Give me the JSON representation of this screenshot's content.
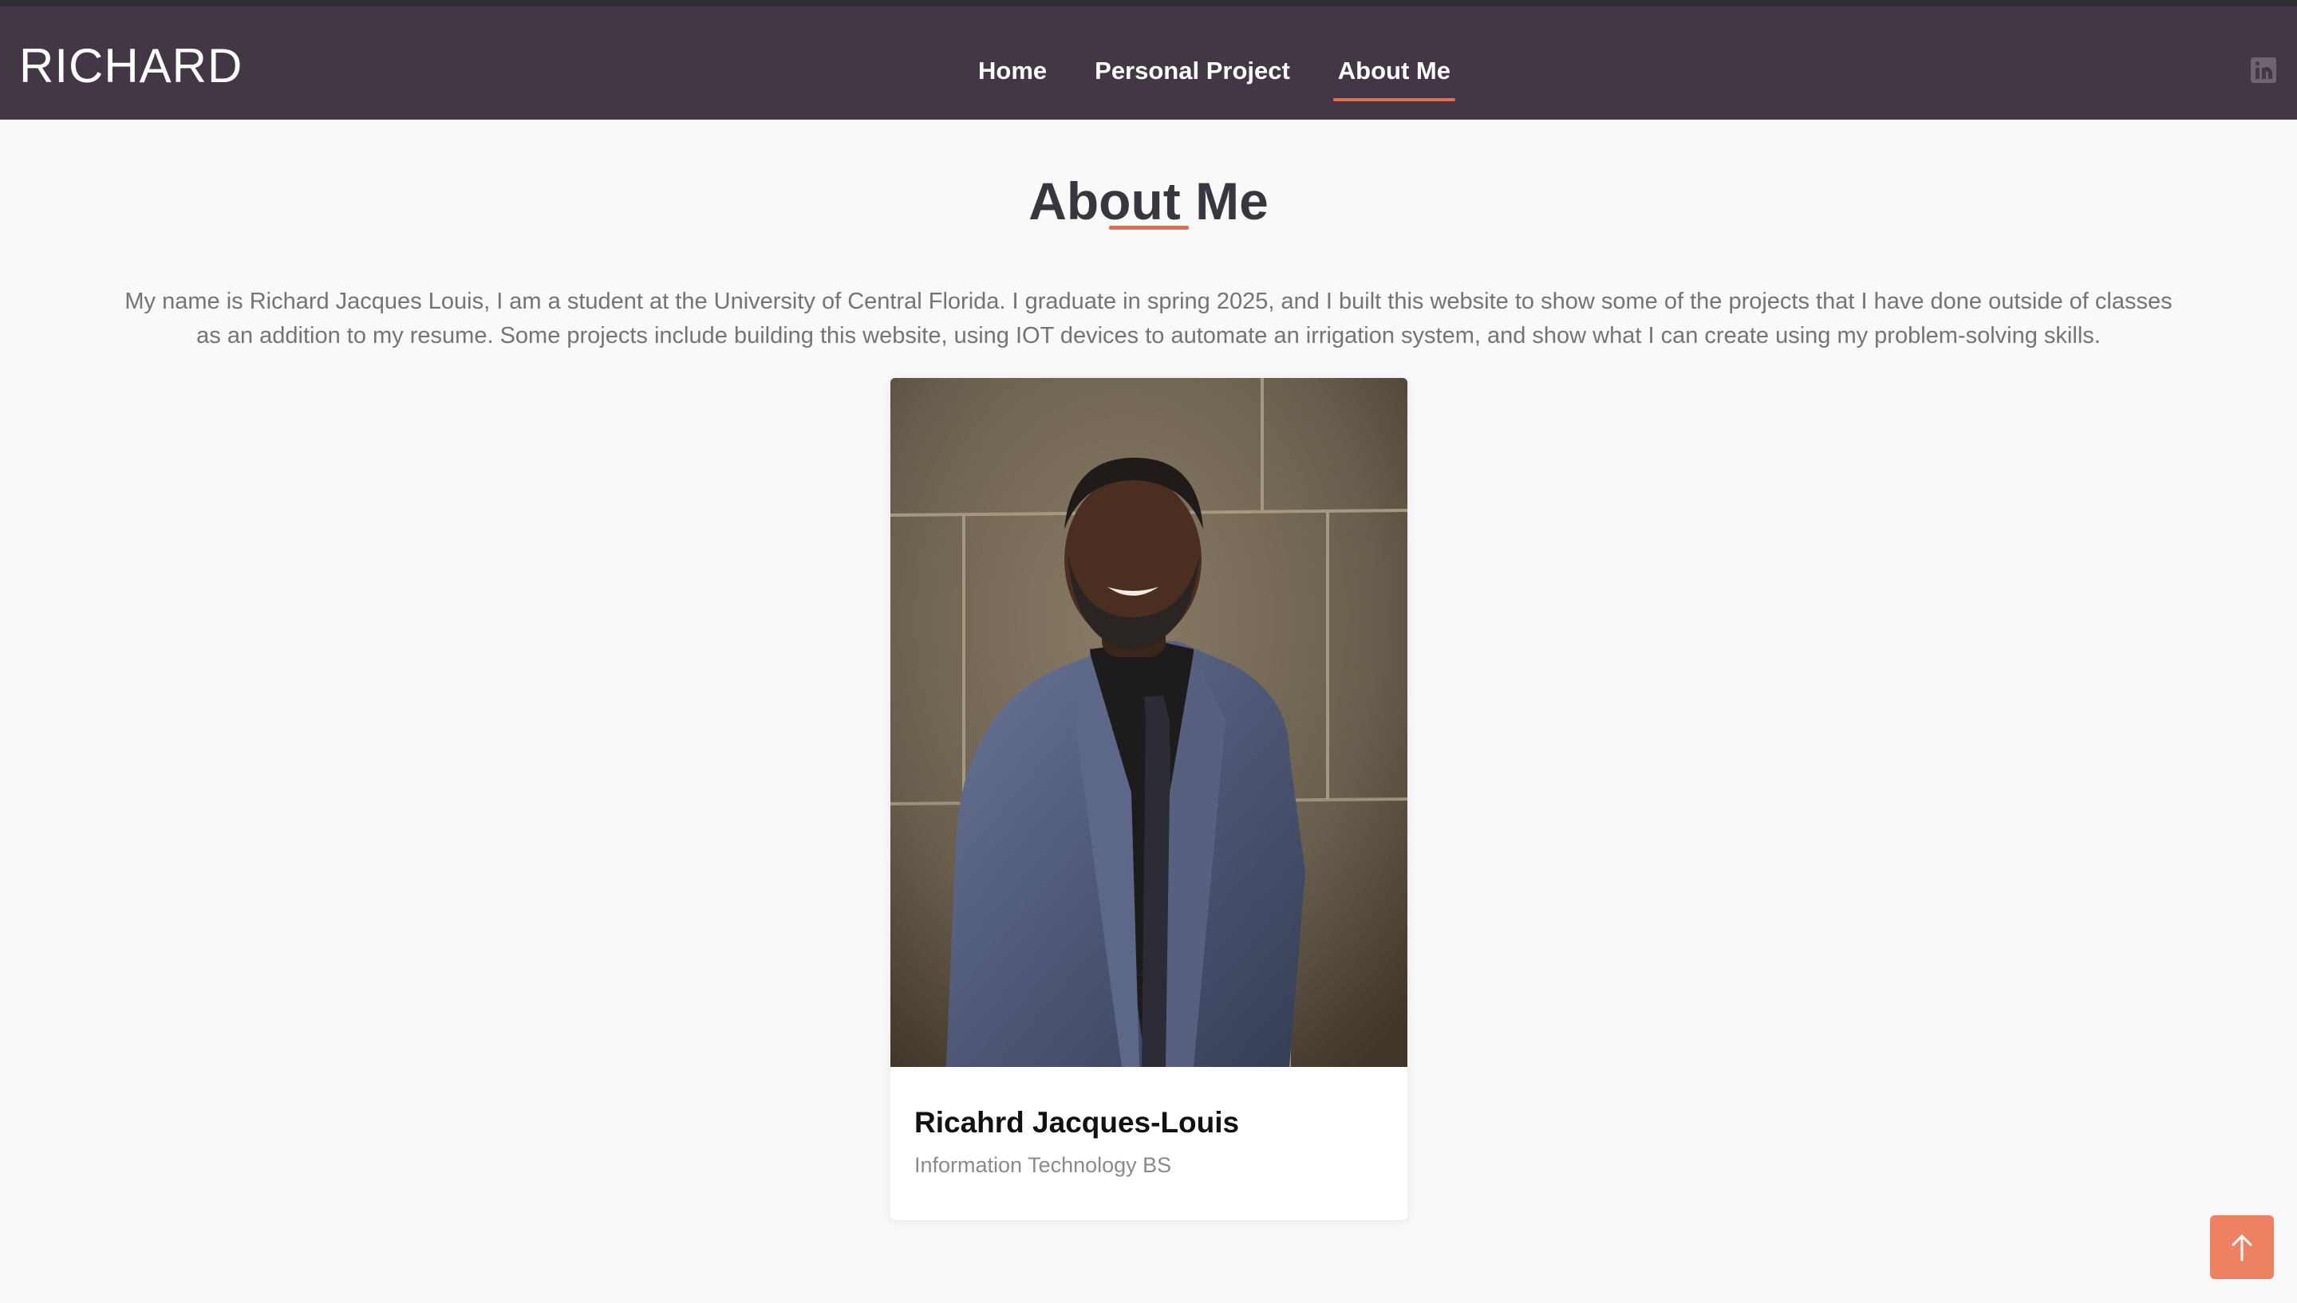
{
  "header": {
    "logo": "RICHARD",
    "nav": [
      {
        "label": "Home",
        "active": false
      },
      {
        "label": "Personal Project",
        "active": false
      },
      {
        "label": "About Me",
        "active": true
      }
    ],
    "social_icon": "linkedin-icon",
    "colors": {
      "background": "#433645",
      "accent": "#e96b56"
    }
  },
  "main": {
    "title": "About Me",
    "intro": "My name is Richard Jacques Louis, I am a student at the University of Central Florida. I graduate in spring 2025, and I built this website to show some of the projects that I have done outside of classes as an addition to my resume. Some projects include building this website, using IOT devices to automate an irrigation system, and show what I can create using my problem-solving skills.",
    "card": {
      "name": "Ricahrd Jacques-Louis",
      "role": "Information Technology BS"
    }
  },
  "back_to_top": {
    "icon": "arrow-up-icon",
    "color": "#ed8161"
  }
}
